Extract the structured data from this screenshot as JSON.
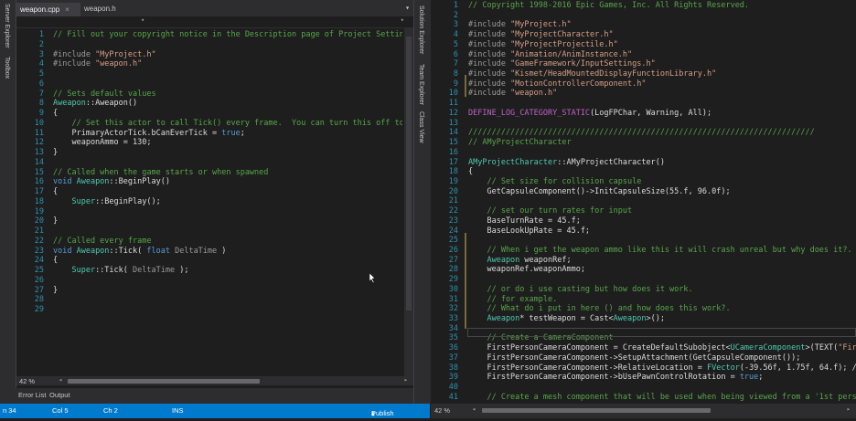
{
  "tabs": [
    {
      "label": "weapon.cpp",
      "close": "×"
    },
    {
      "label": "weapon.h"
    }
  ],
  "left_strip_labels": [
    "Server Explorer",
    "Toolbox"
  ],
  "mid_strip_labels": [
    "Solution Explorer",
    "Team Explorer",
    "Class View"
  ],
  "left_zoom": "42 %",
  "right_zoom": "42 %",
  "bottom_tabs": [
    "Error List",
    "Output"
  ],
  "status": {
    "line": "n 34",
    "col": "Col 5",
    "ch": "Ch 2",
    "mode": "INS",
    "publish": "Publish"
  },
  "left_lines": [
    {
      "n": "1",
      "seg": [
        [
          "cm",
          "// Fill out your copyright notice in the Description page of Project Settings."
        ]
      ]
    },
    {
      "n": "2",
      "seg": []
    },
    {
      "n": "3",
      "seg": [
        [
          "pp",
          "#include "
        ],
        [
          "st",
          "\"MyProject.h\""
        ]
      ]
    },
    {
      "n": "4",
      "seg": [
        [
          "pp",
          "#include "
        ],
        [
          "st",
          "\"weapon.h\""
        ]
      ]
    },
    {
      "n": "5",
      "seg": []
    },
    {
      "n": "6",
      "seg": []
    },
    {
      "n": "7",
      "seg": [
        [
          "cm",
          "// Sets default values"
        ]
      ]
    },
    {
      "n": "8",
      "seg": [
        [
          "ty",
          "Aweapon"
        ],
        [
          "",
          "::Aweapon()"
        ]
      ]
    },
    {
      "n": "9",
      "seg": [
        [
          "",
          "{"
        ]
      ]
    },
    {
      "n": "10",
      "seg": [
        [
          "cm",
          "    // Set this actor to call Tick() every frame.  You can turn this off to i"
        ]
      ]
    },
    {
      "n": "11",
      "seg": [
        [
          "",
          "    PrimaryActorTick.bCanEverTick = "
        ],
        [
          "kw",
          "true"
        ],
        [
          "",
          ";"
        ]
      ]
    },
    {
      "n": "12",
      "seg": [
        [
          "",
          "    weaponAmmo = 130;"
        ]
      ]
    },
    {
      "n": "13",
      "seg": [
        [
          "",
          "}"
        ]
      ]
    },
    {
      "n": "14",
      "seg": []
    },
    {
      "n": "15",
      "seg": [
        [
          "cm",
          "// Called when the game starts or when spawned"
        ]
      ]
    },
    {
      "n": "16",
      "seg": [
        [
          "kw",
          "void "
        ],
        [
          "ty",
          "Aweapon"
        ],
        [
          "",
          "::BeginPlay()"
        ]
      ]
    },
    {
      "n": "17",
      "seg": [
        [
          "",
          "{"
        ]
      ]
    },
    {
      "n": "18",
      "seg": [
        [
          "ty",
          "    Super"
        ],
        [
          "",
          "::BeginPlay();"
        ]
      ]
    },
    {
      "n": "19",
      "seg": []
    },
    {
      "n": "20",
      "seg": [
        [
          "",
          "}"
        ]
      ]
    },
    {
      "n": "21",
      "seg": []
    },
    {
      "n": "22",
      "seg": [
        [
          "cm",
          "// Called every frame"
        ]
      ]
    },
    {
      "n": "23",
      "seg": [
        [
          "kw",
          "void "
        ],
        [
          "ty",
          "Aweapon"
        ],
        [
          "",
          "::Tick( "
        ],
        [
          "kw",
          "float "
        ],
        [
          "pa",
          "DeltaTime"
        ],
        [
          "",
          " )"
        ]
      ]
    },
    {
      "n": "24",
      "seg": [
        [
          "",
          "{"
        ]
      ]
    },
    {
      "n": "25",
      "seg": [
        [
          "ty",
          "    Super"
        ],
        [
          "",
          "::Tick( "
        ],
        [
          "pa",
          "DeltaTime"
        ],
        [
          "",
          " );"
        ]
      ]
    },
    {
      "n": "26",
      "seg": []
    },
    {
      "n": "27",
      "seg": [
        [
          "",
          "}"
        ]
      ]
    },
    {
      "n": "28",
      "seg": []
    },
    {
      "n": "29",
      "seg": []
    }
  ],
  "right_lines": [
    {
      "n": "1",
      "seg": [
        [
          "cm",
          "// Copyright 1998-2016 Epic Games, Inc. All Rights Reserved."
        ]
      ]
    },
    {
      "n": "2",
      "seg": []
    },
    {
      "n": "3",
      "seg": [
        [
          "pp",
          "#include "
        ],
        [
          "st",
          "\"MyProject.h\""
        ]
      ]
    },
    {
      "n": "4",
      "seg": [
        [
          "pp",
          "#include "
        ],
        [
          "st",
          "\"MyProjectCharacter.h\""
        ]
      ]
    },
    {
      "n": "5",
      "seg": [
        [
          "pp",
          "#include "
        ],
        [
          "st",
          "\"MyProjectProjectile.h\""
        ]
      ]
    },
    {
      "n": "6",
      "seg": [
        [
          "pp",
          "#include "
        ],
        [
          "st",
          "\"Animation/AnimInstance.h\""
        ]
      ]
    },
    {
      "n": "7",
      "seg": [
        [
          "pp",
          "#include "
        ],
        [
          "st",
          "\"GameFramework/InputSettings.h\""
        ]
      ]
    },
    {
      "n": "8",
      "seg": [
        [
          "pp",
          "#include "
        ],
        [
          "st",
          "\"Kismet/HeadMountedDisplayFunctionLibrary.h\""
        ]
      ]
    },
    {
      "n": "9",
      "seg": [
        [
          "pp",
          "#include "
        ],
        [
          "st",
          "\"MotionControllerComponent.h\""
        ]
      ]
    },
    {
      "n": "10",
      "seg": [
        [
          "pp",
          "#include "
        ],
        [
          "st",
          "\"weapon.h\""
        ]
      ]
    },
    {
      "n": "11",
      "seg": []
    },
    {
      "n": "12",
      "seg": [
        [
          "mc",
          "DEFINE_LOG_CATEGORY_STATIC"
        ],
        [
          "",
          "(LogFPChar, Warning, All);"
        ]
      ]
    },
    {
      "n": "13",
      "seg": []
    },
    {
      "n": "14",
      "seg": [
        [
          "cm",
          "//////////////////////////////////////////////////////////////////////////"
        ]
      ]
    },
    {
      "n": "15",
      "seg": [
        [
          "cm",
          "// AMyProjectCharacter"
        ]
      ]
    },
    {
      "n": "16",
      "seg": []
    },
    {
      "n": "17",
      "seg": [
        [
          "ty",
          "AMyProjectCharacter"
        ],
        [
          "",
          "::AMyProjectCharacter()"
        ]
      ]
    },
    {
      "n": "18",
      "seg": [
        [
          "",
          "{"
        ]
      ]
    },
    {
      "n": "19",
      "seg": [
        [
          "cm",
          "    // Set size for collision capsule"
        ]
      ]
    },
    {
      "n": "20",
      "seg": [
        [
          "",
          "    GetCapsuleComponent()->InitCapsuleSize(55.f, 96.0f);"
        ]
      ]
    },
    {
      "n": "21",
      "seg": []
    },
    {
      "n": "22",
      "seg": [
        [
          "cm",
          "    // set our turn rates for input"
        ]
      ]
    },
    {
      "n": "23",
      "seg": [
        [
          "",
          "    BaseTurnRate = 45.f;"
        ]
      ]
    },
    {
      "n": "24",
      "seg": [
        [
          "",
          "    BaseLookUpRate = 45.f;"
        ]
      ]
    },
    {
      "n": "25",
      "seg": []
    },
    {
      "n": "26",
      "seg": [
        [
          "cm",
          "    // When i get the weapon ammo like this it will crash unreal but why does it?."
        ]
      ]
    },
    {
      "n": "27",
      "seg": [
        [
          "ty",
          "    Aweapon"
        ],
        [
          "",
          " weaponRef;"
        ]
      ]
    },
    {
      "n": "28",
      "seg": [
        [
          "",
          "    weaponRef.weaponAmmo;"
        ]
      ]
    },
    {
      "n": "29",
      "seg": []
    },
    {
      "n": "30",
      "seg": [
        [
          "cm",
          "    // or do i use casting but how does it work."
        ]
      ]
    },
    {
      "n": "31",
      "seg": [
        [
          "cm",
          "    // for example."
        ]
      ]
    },
    {
      "n": "32",
      "seg": [
        [
          "cm",
          "    // What do i put in here () and how does this work?."
        ]
      ]
    },
    {
      "n": "33",
      "seg": [
        [
          "ty",
          "    Aweapon"
        ],
        [
          "",
          "* testWeapon = Cast<"
        ],
        [
          "ty",
          "Aweapon"
        ],
        [
          "",
          ">();"
        ]
      ]
    },
    {
      "n": "34",
      "seg": []
    },
    {
      "n": "35",
      "seg": [
        [
          "cm",
          "    // Create a CameraComponent"
        ]
      ]
    },
    {
      "n": "36",
      "seg": [
        [
          "",
          "    FirstPersonCameraComponent = CreateDefaultSubobject<"
        ],
        [
          "ty",
          "UCameraComponent"
        ],
        [
          "",
          ">(TEXT("
        ],
        [
          "st",
          "\"Fir"
        ]
      ]
    },
    {
      "n": "37",
      "seg": [
        [
          "",
          "    FirstPersonCameraComponent->SetupAttachment(GetCapsuleComponent());"
        ]
      ]
    },
    {
      "n": "38",
      "seg": [
        [
          "",
          "    FirstPersonCameraComponent->RelativeLocation = "
        ],
        [
          "ty",
          "FVector"
        ],
        [
          "",
          "(-39.56f, 1.75f, 64.f); //"
        ]
      ]
    },
    {
      "n": "39",
      "seg": [
        [
          "",
          "    FirstPersonCameraComponent->bUsePawnControlRotation = "
        ],
        [
          "kw",
          "true"
        ],
        [
          "",
          ";"
        ]
      ]
    },
    {
      "n": "40",
      "seg": []
    },
    {
      "n": "41",
      "seg": [
        [
          "cm",
          "    // Create a mesh component that will be used when being viewed from a '1st pers"
        ]
      ]
    }
  ]
}
